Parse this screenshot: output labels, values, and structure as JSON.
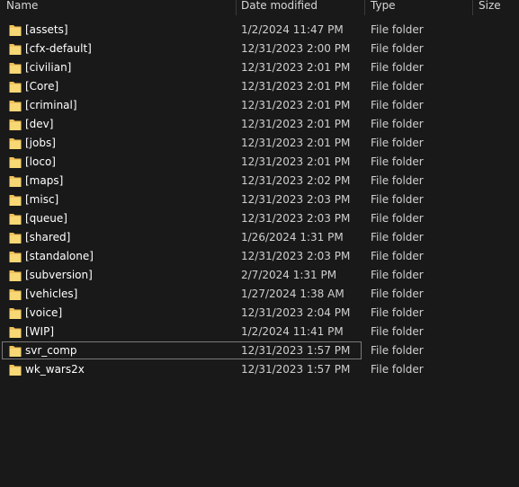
{
  "columns": {
    "name": "Name",
    "date_modified": "Date modified",
    "type": "Type",
    "size": "Size"
  },
  "colors": {
    "background": "#191919",
    "folder_icon": "#f1c25a",
    "focus_border": "#7a7a7a"
  },
  "focused_index": 18,
  "files": [
    {
      "name": "[assets]",
      "date": "1/2/2024 11:47 PM",
      "type": "File folder"
    },
    {
      "name": "[cfx-default]",
      "date": "12/31/2023 2:00 PM",
      "type": "File folder"
    },
    {
      "name": "[civilian]",
      "date": "12/31/2023 2:01 PM",
      "type": "File folder"
    },
    {
      "name": "[Core]",
      "date": "12/31/2023 2:01 PM",
      "type": "File folder"
    },
    {
      "name": "[criminal]",
      "date": "12/31/2023 2:01 PM",
      "type": "File folder"
    },
    {
      "name": "[dev]",
      "date": "12/31/2023 2:01 PM",
      "type": "File folder"
    },
    {
      "name": "[jobs]",
      "date": "12/31/2023 2:01 PM",
      "type": "File folder"
    },
    {
      "name": "[loco]",
      "date": "12/31/2023 2:01 PM",
      "type": "File folder"
    },
    {
      "name": "[maps]",
      "date": "12/31/2023 2:02 PM",
      "type": "File folder"
    },
    {
      "name": "[misc]",
      "date": "12/31/2023 2:03 PM",
      "type": "File folder"
    },
    {
      "name": "[queue]",
      "date": "12/31/2023 2:03 PM",
      "type": "File folder"
    },
    {
      "name": "[shared]",
      "date": "1/26/2024 1:31 PM",
      "type": "File folder"
    },
    {
      "name": "[standalone]",
      "date": "12/31/2023 2:03 PM",
      "type": "File folder"
    },
    {
      "name": "[subversion]",
      "date": "2/7/2024 1:31 PM",
      "type": "File folder"
    },
    {
      "name": "[vehicles]",
      "date": "1/27/2024 1:38 AM",
      "type": "File folder"
    },
    {
      "name": "[voice]",
      "date": "12/31/2023 2:04 PM",
      "type": "File folder"
    },
    {
      "name": "[WIP]",
      "date": "1/2/2024 11:41 PM",
      "type": "File folder"
    },
    {
      "name": "svr_comp",
      "date": "12/31/2023 1:57 PM",
      "type": "File folder"
    },
    {
      "name": "wk_wars2x",
      "date": "12/31/2023 1:57 PM",
      "type": "File folder"
    }
  ]
}
